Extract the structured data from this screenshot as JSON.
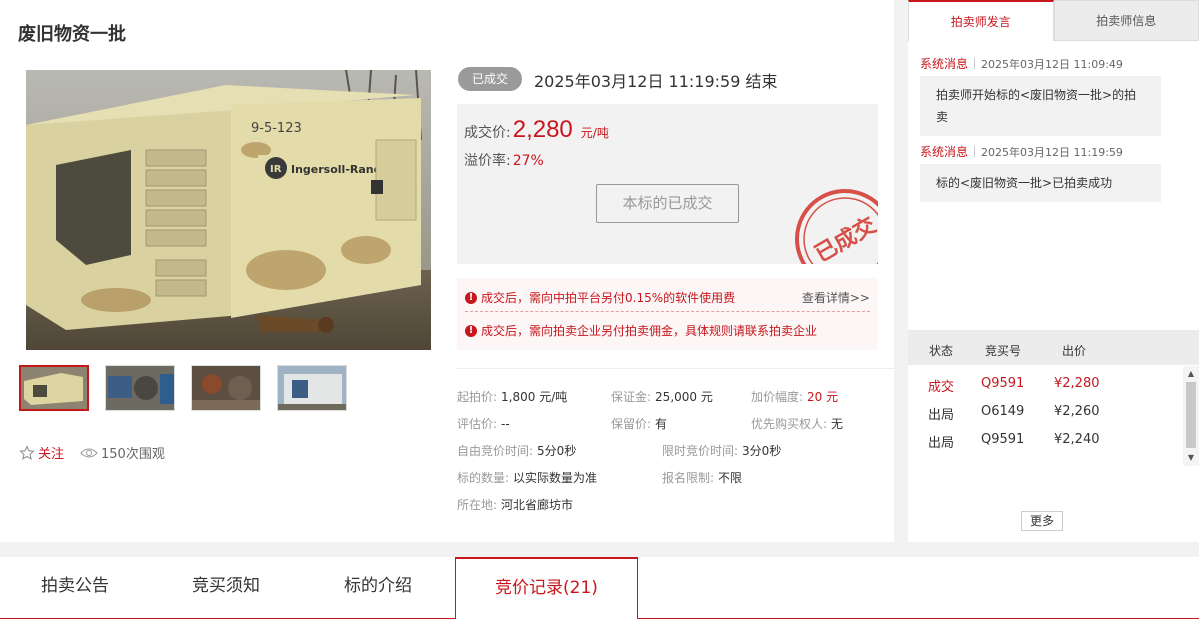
{
  "lot": {
    "title": "废旧物资一批",
    "machine_brand_text": "Ingersoll-Rand",
    "machine_tag_text": "9-5-123"
  },
  "actions": {
    "follow_label": "关注",
    "views_label": "150次围观"
  },
  "status": {
    "badge": "已成交",
    "end_time": "2025年03月12日  11:19:59 结束"
  },
  "price": {
    "deal_label": "成交价:",
    "deal_value": "2,280",
    "deal_unit": "元/吨",
    "premium_label": "溢价率:",
    "premium_value": "27%",
    "done_button": "本标的已成交",
    "stamp_text": "已成交"
  },
  "notice": {
    "line1": "成交后，需向中拍平台另付0.15%的软件使用费",
    "details_link": "查看详情>>",
    "line2": "成交后，需向拍卖企业另付拍卖佣金，具体规则请联系拍卖企业"
  },
  "info": {
    "start_price_label": "起拍价:",
    "start_price": "1,800 元/吨",
    "deposit_label": "保证金:",
    "deposit": "25,000 元",
    "increment_label": "加价幅度:",
    "increment": "20 元",
    "appraisal_label": "评估价:",
    "appraisal": "--",
    "reserve_label": "保留价:",
    "reserve": "有",
    "priority_label": "优先购买权人:",
    "priority": "无",
    "free_time_label": "自由竞价时间:",
    "free_time": "5分0秒",
    "limited_time_label": "限时竞价时间:",
    "limited_time": "3分0秒",
    "quantity_label": "标的数量:",
    "quantity": "以实际数量为准",
    "signup_label": "报名限制:",
    "signup": "不限",
    "location_label": "所在地:",
    "location": "河北省廊坊市"
  },
  "side": {
    "tabs": [
      "拍卖师发言",
      "拍卖师信息"
    ],
    "messages": [
      {
        "source": "系统消息",
        "time": "2025年03月12日  11:09:49",
        "text": "拍卖师开始标的<废旧物资一批>的拍卖"
      },
      {
        "source": "系统消息",
        "time": "2025年03月12日  11:19:59",
        "text": "标的<废旧物资一批>已拍卖成功"
      }
    ],
    "bid_headers": [
      "状态",
      "竞买号",
      "出价"
    ],
    "bids": [
      {
        "status": "成交",
        "bidder": "Q9591",
        "price": "¥2,280"
      },
      {
        "status": "出局",
        "bidder": "O6149",
        "price": "¥2,260"
      },
      {
        "status": "出局",
        "bidder": "Q9591",
        "price": "¥2,240"
      }
    ],
    "more_label": "更多"
  },
  "bottom_tabs": [
    "拍卖公告",
    "竞买须知",
    "标的介绍",
    "竞价记录(21)"
  ],
  "colors": {
    "accent": "#c8161d",
    "badge_gray": "#9a9a9a",
    "panel_bg": "#f2f2f2"
  }
}
